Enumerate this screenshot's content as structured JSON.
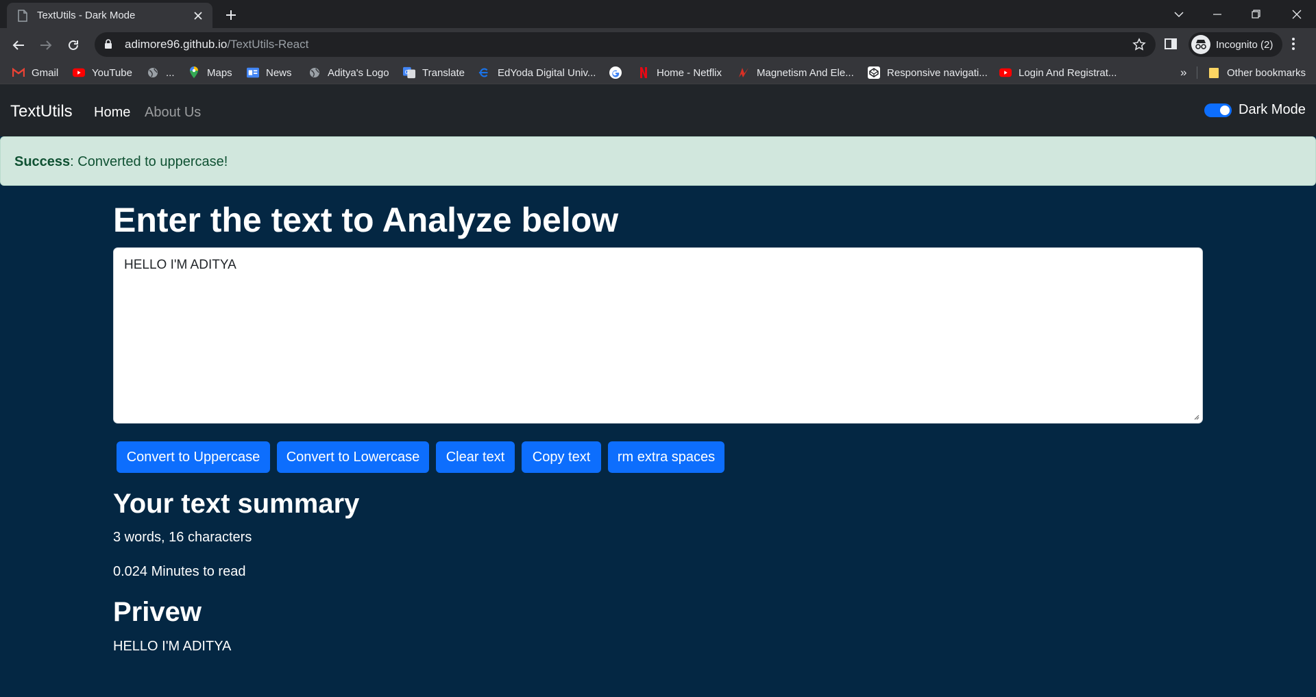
{
  "browser": {
    "tab_title": "TextUtils - Dark Mode",
    "url_host": "adimore96.github.io",
    "url_path": "/TextUtils-React",
    "profile_label": "Incognito (2)",
    "bookmarks": [
      {
        "label": "Gmail",
        "icon": "gmail-icon"
      },
      {
        "label": "YouTube",
        "icon": "youtube-icon"
      },
      {
        "label": "...",
        "icon": "globe-icon"
      },
      {
        "label": "Maps",
        "icon": "maps-icon"
      },
      {
        "label": "News",
        "icon": "news-icon"
      },
      {
        "label": "Aditya's Logo",
        "icon": "globe-icon"
      },
      {
        "label": "Translate",
        "icon": "translate-icon"
      },
      {
        "label": "EdYoda Digital Univ...",
        "icon": "edyoda-icon"
      },
      {
        "label": "",
        "icon": "google-icon"
      },
      {
        "label": "Home - Netflix",
        "icon": "netflix-icon"
      },
      {
        "label": "Magnetism And Ele...",
        "icon": "bookmark-site-icon"
      },
      {
        "label": "Responsive navigati...",
        "icon": "codepen-icon"
      },
      {
        "label": "Login And Registrat...",
        "icon": "youtube-icon"
      }
    ],
    "more_bookmarks": "»",
    "other_bookmarks": "Other bookmarks"
  },
  "app": {
    "brand": "TextUtils",
    "nav": {
      "home": "Home",
      "about": "About Us"
    },
    "mode_label": "Dark Mode",
    "mode_enabled": true,
    "alert": {
      "type": "Success",
      "message": ": Converted to uppercase!"
    },
    "heading": "Enter the text to Analyze below",
    "textarea_value": "HELLO I'M ADITYA",
    "buttons": {
      "uppercase": "Convert to Uppercase",
      "lowercase": "Convert to Lowercase",
      "clear": "Clear text",
      "copy": "Copy text",
      "spaces": "rm extra spaces"
    },
    "summary_heading": "Your text summary",
    "summary_counts": "3 words, 16 characters",
    "summary_read_time": "0.024 Minutes to read",
    "preview_heading": "Privew",
    "preview_text": "HELLO I'M ADITYA"
  },
  "colors": {
    "page_bg": "#042743",
    "navbar_bg": "#212529",
    "accent": "#0d6efd",
    "alert_bg": "#d1e7dd",
    "alert_text": "#0f5132"
  }
}
